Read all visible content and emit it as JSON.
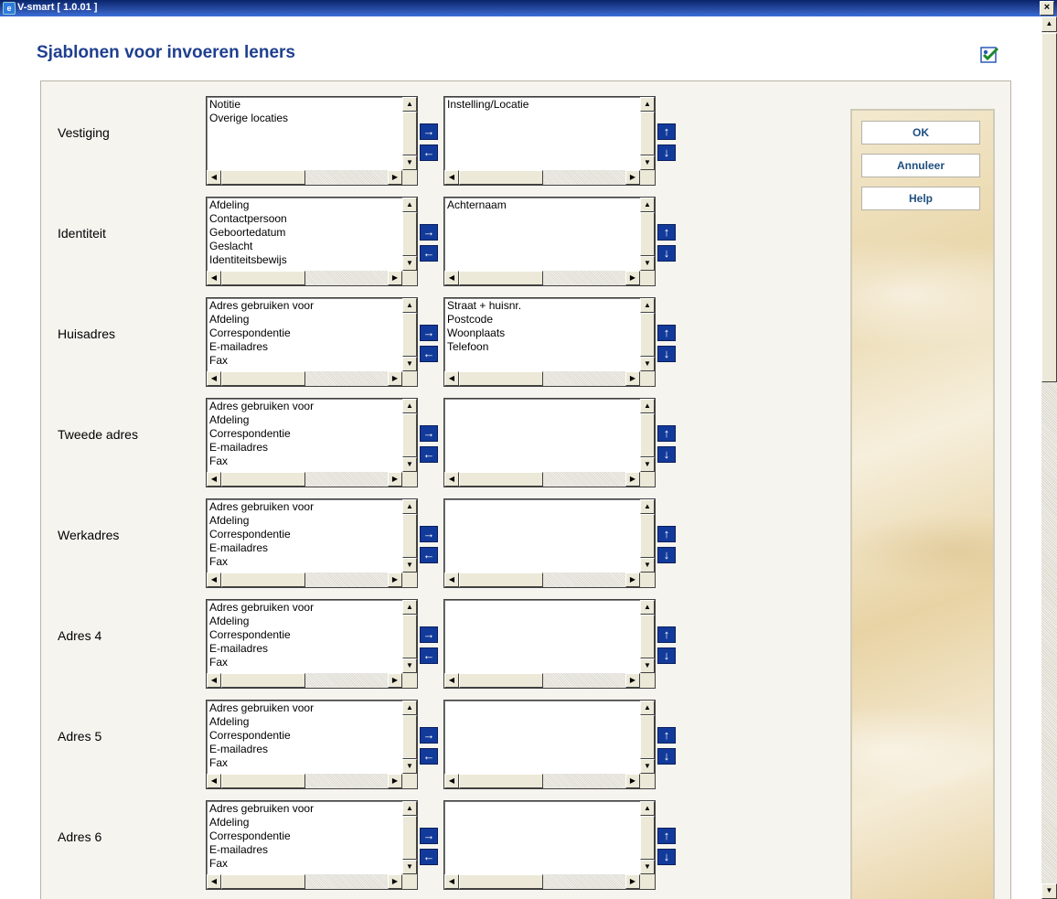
{
  "window": {
    "title": "V-smart [ 1.0.01 ]",
    "close_label": "×"
  },
  "page": {
    "title": "Sjablonen voor invoeren leners"
  },
  "side_buttons": {
    "ok": "OK",
    "cancel": "Annuleer",
    "help": "Help"
  },
  "glyphs": {
    "right": "→",
    "left": "←",
    "up": "↑",
    "down": "↓",
    "sb_up": "▲",
    "sb_down": "▼",
    "sb_left": "◀",
    "sb_right": "▶"
  },
  "rows": [
    {
      "label": "Vestiging",
      "available": [
        "Notitie",
        "Overige locaties"
      ],
      "selected": [
        "Instelling/Locatie"
      ]
    },
    {
      "label": "Identiteit",
      "available": [
        "Afdeling",
        "Contactpersoon",
        "Geboortedatum",
        "Geslacht",
        "Identiteitsbewijs"
      ],
      "selected": [
        "Achternaam"
      ]
    },
    {
      "label": "Huisadres",
      "available": [
        "Adres gebruiken voor",
        "Afdeling",
        "Correspondentie",
        "E-mailadres",
        "Fax"
      ],
      "selected": [
        "Straat + huisnr.",
        "Postcode",
        "Woonplaats",
        "Telefoon"
      ]
    },
    {
      "label": "Tweede adres",
      "available": [
        "Adres gebruiken voor",
        "Afdeling",
        "Correspondentie",
        "E-mailadres",
        "Fax"
      ],
      "selected": []
    },
    {
      "label": "Werkadres",
      "available": [
        "Adres gebruiken voor",
        "Afdeling",
        "Correspondentie",
        "E-mailadres",
        "Fax"
      ],
      "selected": []
    },
    {
      "label": "Adres 4",
      "available": [
        "Adres gebruiken voor",
        "Afdeling",
        "Correspondentie",
        "E-mailadres",
        "Fax"
      ],
      "selected": []
    },
    {
      "label": "Adres 5",
      "available": [
        "Adres gebruiken voor",
        "Afdeling",
        "Correspondentie",
        "E-mailadres",
        "Fax"
      ],
      "selected": []
    },
    {
      "label": "Adres 6",
      "available": [
        "Adres gebruiken voor",
        "Afdeling",
        "Correspondentie",
        "E-mailadres",
        "Fax"
      ],
      "selected": []
    }
  ]
}
